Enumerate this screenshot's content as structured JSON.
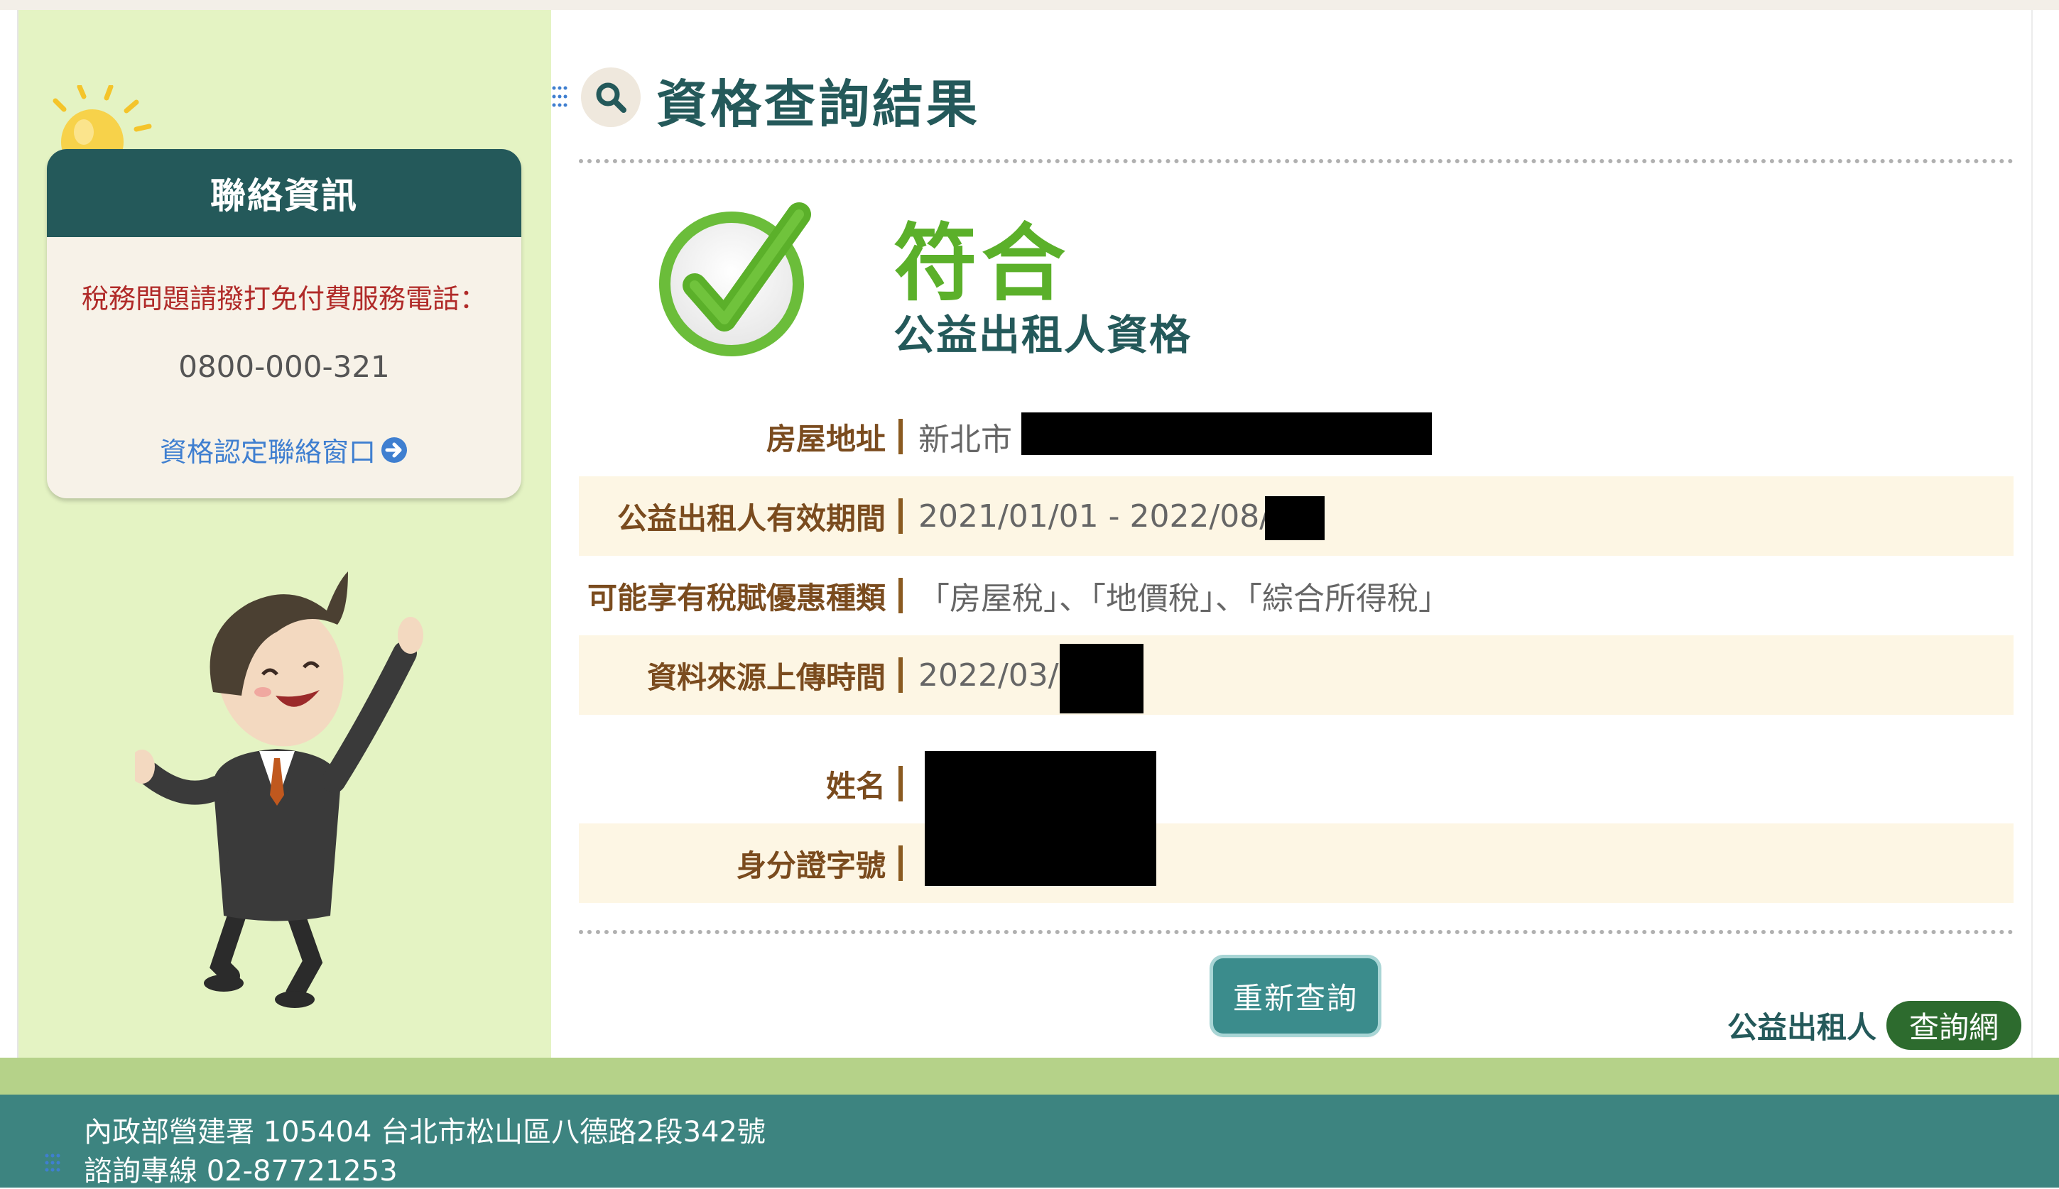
{
  "sidebar": {
    "contact": {
      "title": "聯絡資訊",
      "phone_label": "稅務問題請撥打免付費服務電話：",
      "phone": "0800-000-321",
      "link_label": "資格認定聯絡窗口"
    }
  },
  "main": {
    "title": "資格查詢結果",
    "result": {
      "status": "符合",
      "type": "公益出租人資格"
    },
    "rows": [
      {
        "label": "房屋地址",
        "value": "新北市"
      },
      {
        "label": "公益出租人有效期間",
        "value": "2021/01/01 - 2022/08/"
      },
      {
        "label": "可能享有稅賦優惠種類",
        "value": "「房屋稅」、「地價稅」、「綜合所得稅」"
      },
      {
        "label": "資料來源上傳時間",
        "value": "2022/03/"
      },
      {
        "label": "姓名",
        "value": ""
      },
      {
        "label": "身分證字號",
        "value": ""
      }
    ],
    "requery_label": "重新查詢"
  },
  "brand": {
    "text": "公益出租人",
    "pill": "查詢網"
  },
  "footer": {
    "address": "內政部營建署 105404 台北市松山區八德路2段342號",
    "hotline": "諮詢專線 02-87721253"
  },
  "colors": {
    "dark_teal": "#24595a",
    "sidebar_bg": "#e4f3c3",
    "success_green": "#5bb02a",
    "footer_teal": "#3d8480",
    "row_highlight": "#fdf6e4",
    "label_brown": "#7a4b1e",
    "phone_red": "#b02a28"
  }
}
